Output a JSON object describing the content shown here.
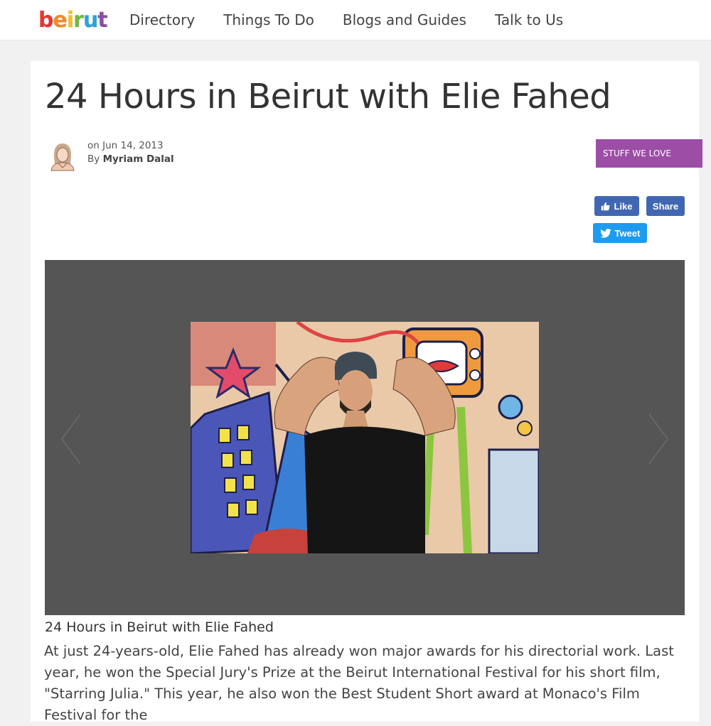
{
  "header": {
    "logo_letters": [
      "b",
      "e",
      "i",
      "r",
      "u",
      "t"
    ],
    "logo_colors": [
      "#e8362f",
      "#f28c28",
      "#f6c21b",
      "#74b943",
      "#2aa3dc",
      "#8a4f9e"
    ],
    "nav": [
      "Directory",
      "Things To Do",
      "Blogs and Guides",
      "Talk to Us"
    ]
  },
  "article": {
    "title": "24 Hours in Beirut with Elie Fahed",
    "date": "on Jun 14, 2013",
    "by_prefix": "By",
    "author": "Myriam Dalal",
    "category": "STUFF WE LOVE",
    "share": {
      "like": "Like",
      "share": "Share",
      "tweet": "Tweet"
    },
    "caption": "24 Hours in Beirut with Elie Fahed",
    "body": "At just 24-years-old, Elie Fahed has already won major awards for his directorial work. Last year, he won the Special Jury's Prize at the Beirut International Festival for his short film, \"Starring Julia.\" This year, he also won the Best Student Short award at Monaco's Film Festival for the"
  },
  "colors": {
    "category_bg": "#9c4ea6",
    "facebook": "#4267b2",
    "twitter": "#1d9bf0",
    "gallery_bg": "#555555"
  }
}
